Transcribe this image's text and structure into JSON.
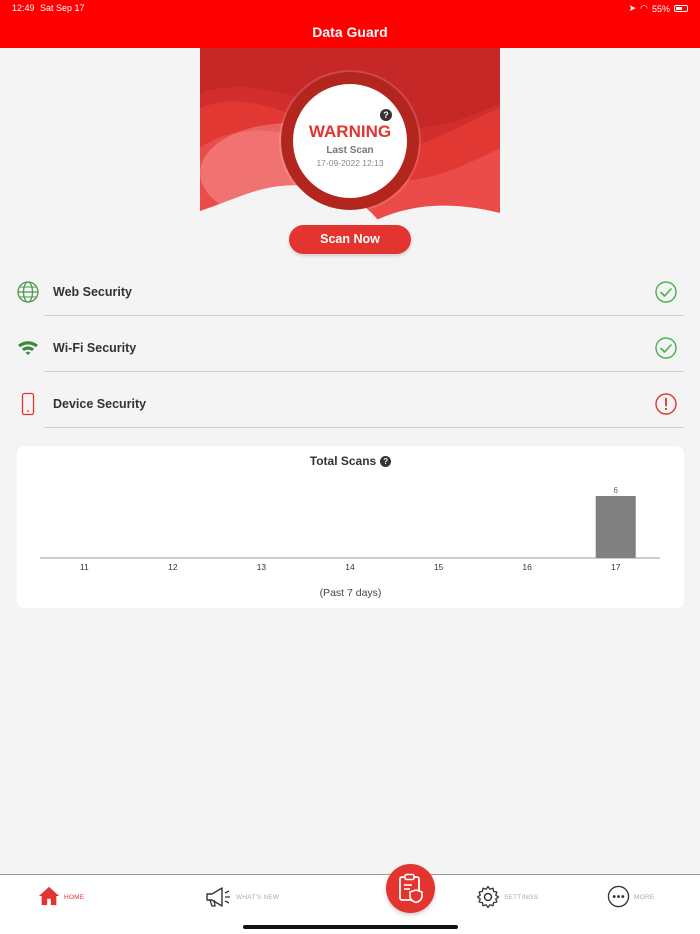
{
  "status_bar": {
    "time": "12:49",
    "date": "Sat Sep 17",
    "battery": "55%"
  },
  "nav": {
    "title": "Data Guard"
  },
  "hero": {
    "status": "WARNING",
    "last_scan_label": "Last Scan",
    "last_scan_date": "17-09-2022 12:13",
    "help": "?"
  },
  "scan_button": {
    "label": "Scan Now"
  },
  "security": [
    {
      "label": "Web Security",
      "icon": "globe-icon",
      "status": "ok"
    },
    {
      "label": "Wi-Fi Security",
      "icon": "wifi-icon",
      "status": "ok"
    },
    {
      "label": "Device Security",
      "icon": "phone-icon",
      "status": "warning"
    }
  ],
  "colors": {
    "brand": "#ff0000",
    "accent": "#e3342f",
    "ok": "#4caf50",
    "bar": "#808080"
  },
  "total_scans": {
    "title": "Total Scans",
    "help": "?",
    "footer": "(Past 7 days)"
  },
  "chart_data": {
    "type": "bar",
    "title": "Total Scans",
    "categories": [
      "11",
      "12",
      "13",
      "14",
      "15",
      "16",
      "17"
    ],
    "values": [
      0,
      0,
      0,
      0,
      0,
      0,
      6
    ],
    "value_labels": [
      "",
      "",
      "",
      "",
      "",
      "",
      "6"
    ],
    "xlabel": "(Past 7 days)",
    "ylabel": "",
    "ylim": [
      0,
      6
    ],
    "grid": false
  },
  "tabs": [
    {
      "label": "HOME",
      "icon": "home-icon",
      "active": true
    },
    {
      "label": "WHAT'S NEW",
      "icon": "megaphone-icon",
      "active": false
    },
    {
      "label": "SETTINGS",
      "icon": "gear-icon",
      "active": false
    },
    {
      "label": "MORE",
      "icon": "more-icon",
      "active": false
    }
  ]
}
